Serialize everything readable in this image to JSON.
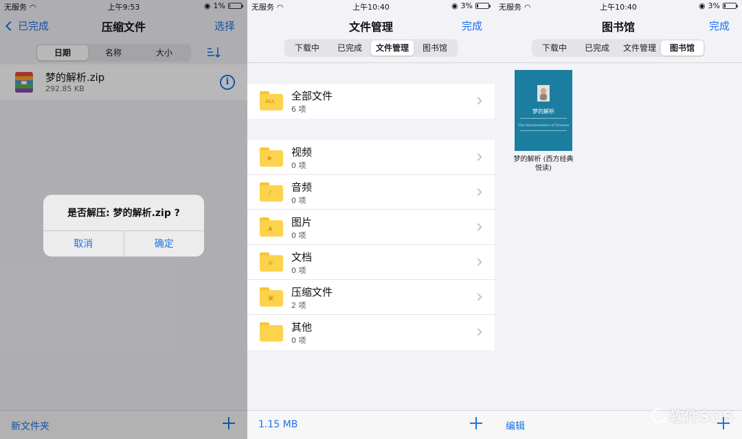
{
  "panel1": {
    "status": {
      "carrier": "无服务",
      "time": "上午9:53",
      "battery": "1%"
    },
    "nav": {
      "back": "已完成",
      "title": "压缩文件",
      "right": "选择"
    },
    "segments": [
      "日期",
      "名称",
      "大小"
    ],
    "active_segment": 0,
    "file": {
      "name": "梦的解析.zip",
      "size": "292.85 KB"
    },
    "alert": {
      "title": "是否解压: 梦的解析.zip ?",
      "cancel": "取消",
      "confirm": "确定"
    },
    "tabbar": {
      "left": "新文件夹"
    }
  },
  "panel2": {
    "status": {
      "carrier": "无服务",
      "time": "上午10:40",
      "battery": "3%"
    },
    "nav": {
      "title": "文件管理",
      "right": "完成"
    },
    "segments": [
      "下载中",
      "已完成",
      "文件管理",
      "图书馆"
    ],
    "active_segment": 2,
    "all_files": {
      "name": "全部文件",
      "count": "6 项",
      "glyph": "ALL"
    },
    "folders": [
      {
        "name": "视频",
        "count": "0 项",
        "glyph": "▶"
      },
      {
        "name": "音频",
        "count": "0 项",
        "glyph": "♪"
      },
      {
        "name": "图片",
        "count": "0 项",
        "glyph": "▲"
      },
      {
        "name": "文档",
        "count": "0 项",
        "glyph": "≡"
      },
      {
        "name": "压缩文件",
        "count": "2 项",
        "glyph": "▣"
      },
      {
        "name": "其他",
        "count": "0 项",
        "glyph": ""
      }
    ],
    "tabbar": {
      "left": "1.15 MB"
    }
  },
  "panel3": {
    "status": {
      "carrier": "无服务",
      "time": "上午10:40",
      "battery": "3%"
    },
    "nav": {
      "title": "图书馆",
      "right": "完成"
    },
    "segments": [
      "下载中",
      "已完成",
      "文件管理",
      "图书馆"
    ],
    "active_segment": 3,
    "book": {
      "cover_title": "梦的解析",
      "cover_subtitle": "The Interpretation of Dreams",
      "caption": "梦的解析 (西方经典悦读)"
    },
    "tabbar": {
      "left": "编辑"
    }
  },
  "watermark": "软件SOS",
  "colors": {
    "accent": "#1a73e8",
    "folder": "#fcd34d",
    "book_cover": "#1b7ea0"
  }
}
